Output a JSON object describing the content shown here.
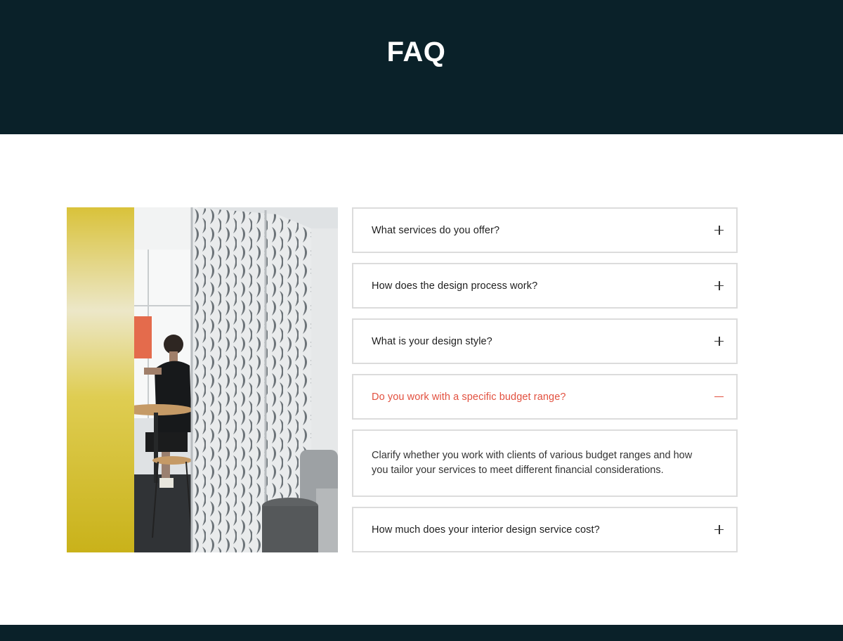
{
  "hero": {
    "title": "FAQ"
  },
  "photo": {
    "description_icon": "office-partition-photo"
  },
  "faq": {
    "items": [
      {
        "question": "What services do you offer?",
        "state": "collapsed",
        "toggle_icon": "plus-icon"
      },
      {
        "question": "How does the design process work?",
        "state": "collapsed",
        "toggle_icon": "plus-icon"
      },
      {
        "question": "What is your design style?",
        "state": "collapsed",
        "toggle_icon": "plus-icon"
      },
      {
        "question": "Do you work with a specific budget range?",
        "state": "expanded",
        "toggle_icon": "minus-icon",
        "answer": "Clarify whether you work with clients of various budget ranges and how you tailor your services to meet different financial considerations."
      },
      {
        "question": "How much does your interior design service cost?",
        "state": "collapsed",
        "toggle_icon": "plus-icon"
      }
    ]
  },
  "colors": {
    "hero_bg": "#0a2129",
    "accent": "#e2503f",
    "border": "#dcdcdc"
  }
}
